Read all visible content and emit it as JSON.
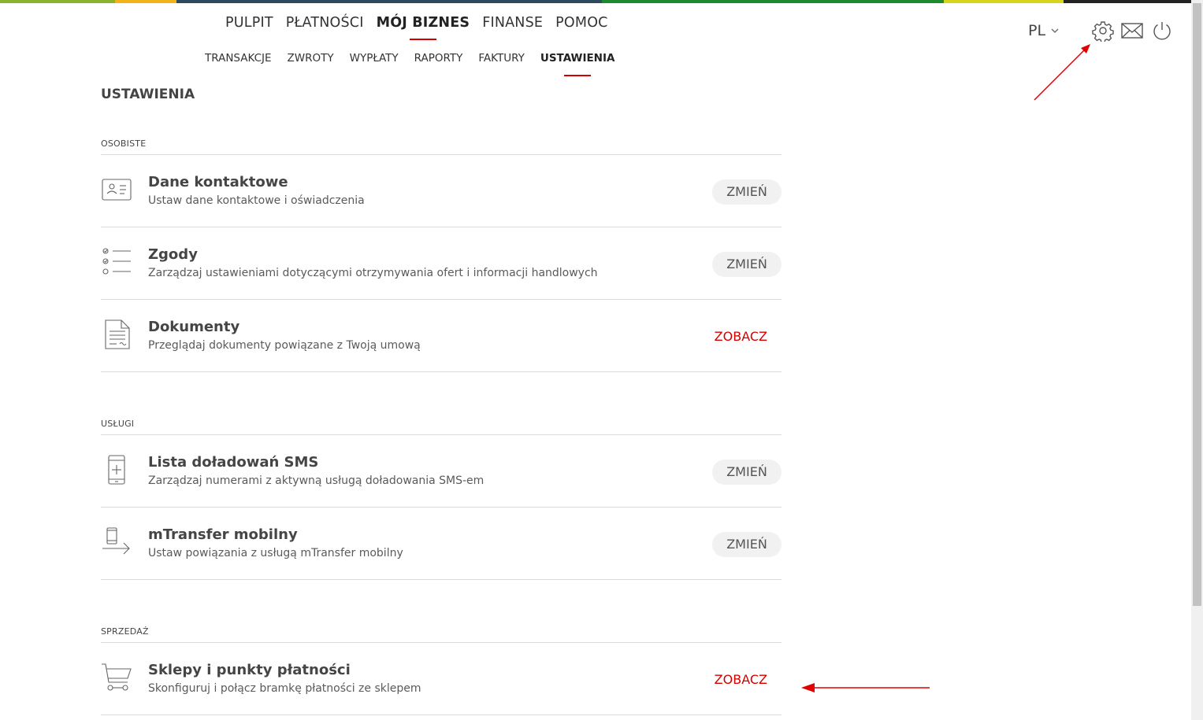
{
  "topbar_colors": [
    "#8bb22c",
    "#f2b318",
    "#2d4b5f",
    "#1e8a2e",
    "#d8d41a",
    "#222222"
  ],
  "accent_color": "#d40000",
  "main_nav": [
    {
      "label": "PULPIT",
      "active": false
    },
    {
      "label": "PŁATNOŚCI",
      "active": false
    },
    {
      "label": "MÓJ BIZNES",
      "active": true
    },
    {
      "label": "FINANSE",
      "active": false
    },
    {
      "label": "POMOC",
      "active": false
    }
  ],
  "sub_nav": [
    {
      "label": "TRANSAKCJE",
      "active": false
    },
    {
      "label": "ZWROTY",
      "active": false
    },
    {
      "label": "WYPŁATY",
      "active": false
    },
    {
      "label": "RAPORTY",
      "active": false
    },
    {
      "label": "FAKTURY",
      "active": false
    },
    {
      "label": "USTAWIENIA",
      "active": true
    }
  ],
  "header": {
    "language": "PL",
    "icons": [
      "gear-icon",
      "envelope-icon",
      "power-icon"
    ]
  },
  "page_title": "USTAWIENIA",
  "sections": [
    {
      "label": "OSOBISTE",
      "items": [
        {
          "icon": "contact-card-icon",
          "title": "Dane kontaktowe",
          "desc": "Ustaw dane kontaktowe i oświadczenia",
          "action": "ZMIEŃ",
          "action_style": "button"
        },
        {
          "icon": "checklist-icon",
          "title": "Zgody",
          "desc": "Zarządzaj ustawieniami dotyczącymi otrzymywania ofert i informacji handlowych",
          "action": "ZMIEŃ",
          "action_style": "button"
        },
        {
          "icon": "document-icon",
          "title": "Dokumenty",
          "desc": "Przeglądaj dokumenty powiązane z Twoją umową",
          "action": "ZOBACZ",
          "action_style": "link"
        }
      ]
    },
    {
      "label": "USŁUGI",
      "items": [
        {
          "icon": "phone-plus-icon",
          "title": "Lista doładowań SMS",
          "desc": "Zarządzaj numerami z aktywną usługą doładowania SMS-em",
          "action": "ZMIEŃ",
          "action_style": "button"
        },
        {
          "icon": "phone-transfer-icon",
          "title": "mTransfer mobilny",
          "desc": "Ustaw powiązania z usługą mTransfer mobilny",
          "action": "ZMIEŃ",
          "action_style": "button"
        }
      ]
    },
    {
      "label": "SPRZEDAŻ",
      "items": [
        {
          "icon": "cart-icon",
          "title": "Sklepy i punkty płatności",
          "desc": "Skonfiguruj i połącz bramkę płatności ze sklepem",
          "action": "ZOBACZ",
          "action_style": "link"
        }
      ]
    }
  ],
  "annotations": [
    {
      "type": "arrow",
      "color": "#e00000",
      "points_to": "gear-icon"
    },
    {
      "type": "arrow",
      "color": "#e00000",
      "points_to": "sklepy-zobacz-link"
    }
  ]
}
